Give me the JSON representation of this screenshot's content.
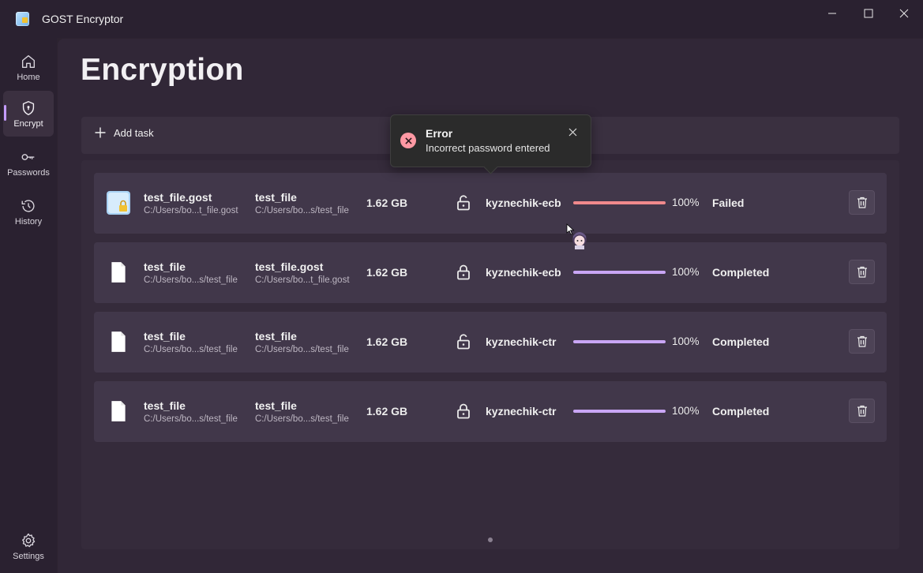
{
  "window": {
    "title": "GOST Encryptor"
  },
  "sidebar": {
    "items": [
      {
        "label": "Home",
        "icon": "home-icon"
      },
      {
        "label": "Encrypt",
        "icon": "shield-icon",
        "active": true
      },
      {
        "label": "Passwords",
        "icon": "key-icon"
      },
      {
        "label": "History",
        "icon": "history-icon"
      }
    ],
    "settings_label": "Settings"
  },
  "page": {
    "title": "Encryption"
  },
  "toolbar": {
    "add_task_label": "Add task"
  },
  "tasks": [
    {
      "source_name": "test_file.gost",
      "source_path": "C:/Users/bo...t_file.gost",
      "dest_name": "test_file",
      "dest_path": "C:/Users/bo...s/test_file",
      "size": "1.62 GB",
      "lock": "unlocked",
      "algorithm": "kyznechik-ecb",
      "progress": 1.0,
      "percent": "100%",
      "status": "Failed"
    },
    {
      "source_name": "test_file",
      "source_path": "C:/Users/bo...s/test_file",
      "dest_name": "test_file.gost",
      "dest_path": "C:/Users/bo...t_file.gost",
      "size": "1.62 GB",
      "lock": "locked",
      "algorithm": "kyznechik-ecb",
      "progress": 1.0,
      "percent": "100%",
      "status": "Completed"
    },
    {
      "source_name": "test_file",
      "source_path": "C:/Users/bo...s/test_file",
      "dest_name": "test_file",
      "dest_path": "C:/Users/bo...s/test_file",
      "size": "1.62 GB",
      "lock": "unlocked",
      "algorithm": "kyznechik-ctr",
      "progress": 1.0,
      "percent": "100%",
      "status": "Completed"
    },
    {
      "source_name": "test_file",
      "source_path": "C:/Users/bo...s/test_file",
      "dest_name": "test_file",
      "dest_path": "C:/Users/bo...s/test_file",
      "size": "1.62 GB",
      "lock": "locked",
      "algorithm": "kyznechik-ctr",
      "progress": 1.0,
      "percent": "100%",
      "status": "Completed"
    }
  ],
  "toast": {
    "title": "Error",
    "message": "Incorrect password entered"
  },
  "colors": {
    "accent": "#c49bff",
    "progress": "#c9a6f5",
    "error": "#f0898c",
    "error_icon": "#ff99a4"
  }
}
